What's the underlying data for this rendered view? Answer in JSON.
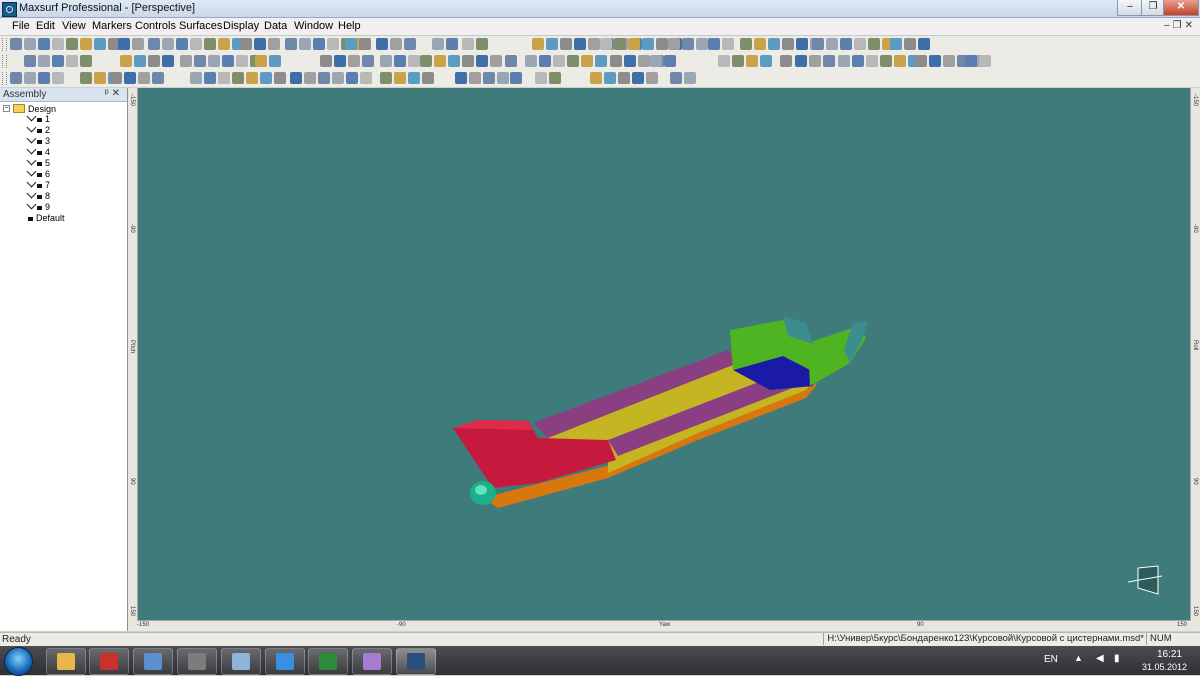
{
  "window": {
    "title": "Maxsurf Professional - [Perspective]"
  },
  "menu": [
    "File",
    "Edit",
    "View",
    "Markers",
    "Controls",
    "Surfaces",
    "Display",
    "Data",
    "Window",
    "Help"
  ],
  "panel": {
    "title": "Assembly",
    "root": "Design",
    "items": [
      "1",
      "2",
      "3",
      "4",
      "5",
      "6",
      "7",
      "8",
      "9"
    ],
    "default_item": "Default"
  },
  "viewport": {
    "background": "#3f7b7b",
    "ruler_left_labels": [
      "-150",
      "-90",
      "Pitch",
      "90",
      "150"
    ],
    "ruler_right_labels": [
      "-150",
      "-90",
      "Roll",
      "90",
      "150"
    ],
    "ruler_bottom_labels": [
      "-150",
      "-90",
      "Yaw",
      "90",
      "150"
    ]
  },
  "hull_colors": {
    "bow": "#c51a3e",
    "bulb": "#1bb08a",
    "bottom_orange": "#d9770f",
    "mid_yellow": "#c6b522",
    "deck_purple": "#8a3f82",
    "stern_green": "#4fb421",
    "transom_blue": "#1a1aa6",
    "stern_teal": "#3c8e8e"
  },
  "status": {
    "ready": "Ready",
    "path": "H:\\Универ\\5курс\\Бондаренко123\\Курсовой\\Курсовой с цистернами.msd*",
    "num": "NUM"
  },
  "tray": {
    "lang": "EN",
    "time": "16:21",
    "date": "31.05.2012"
  },
  "taskbar_icons": [
    "start-orb",
    "explorer",
    "acrobat",
    "network",
    "media",
    "calculator",
    "ie",
    "excel",
    "paint",
    "maxsurf"
  ]
}
